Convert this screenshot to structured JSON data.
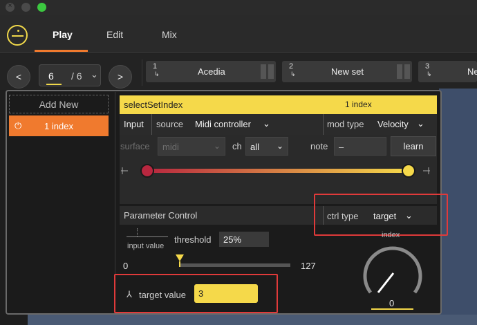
{
  "window": {
    "close_glyph": "×"
  },
  "nav": {
    "tabs": [
      "Play",
      "Edit",
      "Mix"
    ],
    "active_tab": "Play"
  },
  "setnav": {
    "prev_label": "<",
    "next_label": ">",
    "current": "6",
    "total": "/ 6",
    "slots": [
      {
        "index": "1",
        "name": "Acedia"
      },
      {
        "index": "2",
        "name": "New set"
      },
      {
        "index": "3",
        "name": "Ne"
      }
    ]
  },
  "sidebar": {
    "add_new_label": "Add New",
    "items": [
      {
        "label": "1 index",
        "active": true
      }
    ]
  },
  "mapping": {
    "title": "selectSetIndex",
    "count": "1 index",
    "input_tab": "Input",
    "source_label": "source",
    "source_value": "Midi controller",
    "mod_type_label": "mod type",
    "mod_type_value": "Velocity",
    "surface_label": "surface",
    "surface_value": "midi",
    "ch_label": "ch",
    "ch_value": "all",
    "note_label": "note",
    "note_value": "–",
    "learn_label": "learn",
    "range_min": 0.0,
    "range_max": 1.0
  },
  "param": {
    "title": "Parameter Control",
    "ctrl_type_label": "ctrl type",
    "ctrl_type_value": "target",
    "input_value_label": "input value",
    "threshold_label": "threshold",
    "threshold_value": "25%",
    "slider_min": "0",
    "slider_max": "127",
    "slider_value": 0,
    "knob_label": "index",
    "knob_value": "0",
    "target_value_label": "target value",
    "target_value": "3"
  },
  "colors": {
    "accent": "#f07a2e",
    "yellow": "#f5d94a",
    "highlight": "#e03a3a",
    "range_start": "#b8273f"
  }
}
